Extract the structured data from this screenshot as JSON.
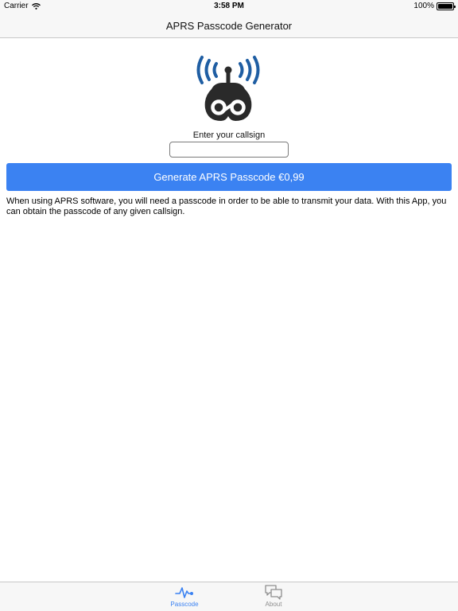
{
  "status_bar": {
    "carrier": "Carrier",
    "time": "3:58 PM",
    "battery": "100%",
    "battery_level": 1.0
  },
  "nav": {
    "title": "APRS Passcode Generator"
  },
  "form": {
    "callsign_label": "Enter your callsign",
    "callsign_value": "",
    "generate_label": "Generate APRS Passcode €0,99"
  },
  "description": "When using APRS software, you will need a passcode in order to be able to transmit your data. With this App, you can obtain the passcode of any given callsign.",
  "tabs": [
    {
      "label": "Passcode",
      "icon": "pulse-icon",
      "selected": true
    },
    {
      "label": "About",
      "icon": "chat-bubbles-icon",
      "selected": false
    }
  ],
  "colors": {
    "accent": "#3b82f2",
    "logo_waves": "#1f5ea3",
    "logo_body": "#2a2a2a",
    "inactive_tab": "#8e8e8e"
  }
}
